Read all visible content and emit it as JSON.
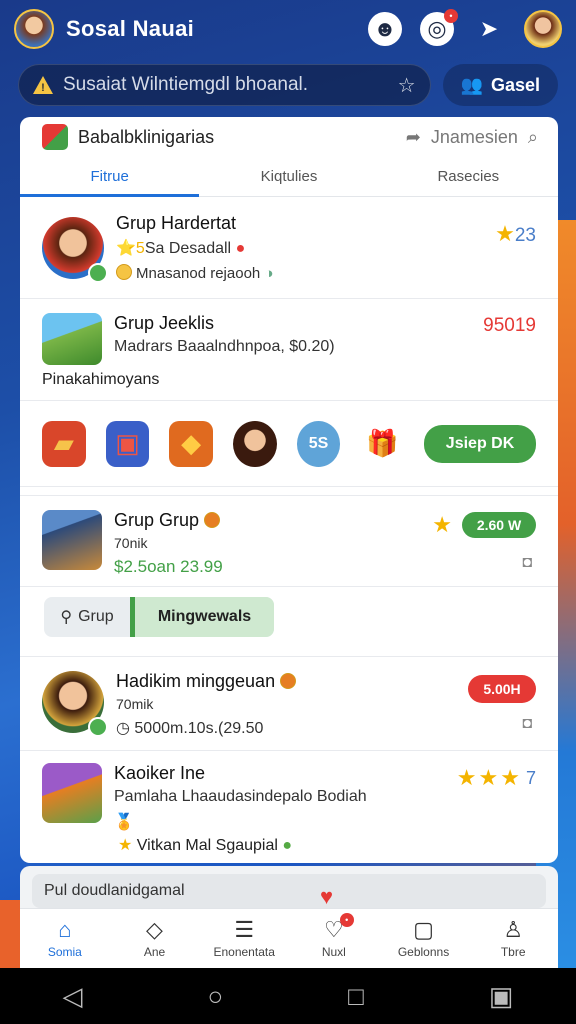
{
  "app": {
    "title": "Sosal Nauai"
  },
  "search": {
    "placeholder": "Susaiat Wilntiemgdl bhoanal.",
    "button_label": "Gasel"
  },
  "panel": {
    "title": "Babalbklinigarias",
    "header_action": "Jnamesien",
    "tabs": [
      {
        "label": "Fitrue"
      },
      {
        "label": "Kiqtulies"
      },
      {
        "label": "Rasecies"
      }
    ]
  },
  "items": [
    {
      "title": "Grup Hardertat",
      "line2": "Sa Desadall",
      "line2_prefix": "⭐5",
      "line3": "Mnasanod rejaooh",
      "value": "23"
    },
    {
      "title": "Grup Jeeklis",
      "line2": "Madrars Baaalndhnpoa, $0.20)",
      "line3": "Pinakahimoyans",
      "value": "95019"
    },
    {
      "title": "Grup Grup",
      "line2": "70nik",
      "line3": "$2.5oan 23.99",
      "pill": "2.60 W"
    },
    {
      "title": "Hadikim minggeuan",
      "line2": "70mik",
      "line3": "5000m.10s.(29.50",
      "pill": "5.00H"
    },
    {
      "title": "Kaoiker Ine",
      "line2": "Pamlaha Lhaaudasindepalo Bodiah",
      "line3": "Vitkan Mal Sgaupial",
      "rating": "7"
    }
  ],
  "icon_row": {
    "action_label": "Jsiep DK",
    "circle_label": "5S"
  },
  "segment": {
    "option_a": "Grup",
    "option_b": "Mingwewals"
  },
  "bottom_input": {
    "text": "Pul doudlanidgamal"
  },
  "nav": [
    {
      "label": "Somia",
      "icon": "home-icon"
    },
    {
      "label": "Ane",
      "icon": "compass-icon"
    },
    {
      "label": "Enonentata",
      "icon": "document-icon"
    },
    {
      "label": "Nuxl",
      "icon": "heart-broken-icon"
    },
    {
      "label": "Geblonns",
      "icon": "chat-icon"
    },
    {
      "label": "Tbre",
      "icon": "person-icon"
    }
  ],
  "colors": {
    "accent": "#1e6fd9",
    "green": "#43a047",
    "red": "#e53935",
    "gold": "#f4b400"
  }
}
